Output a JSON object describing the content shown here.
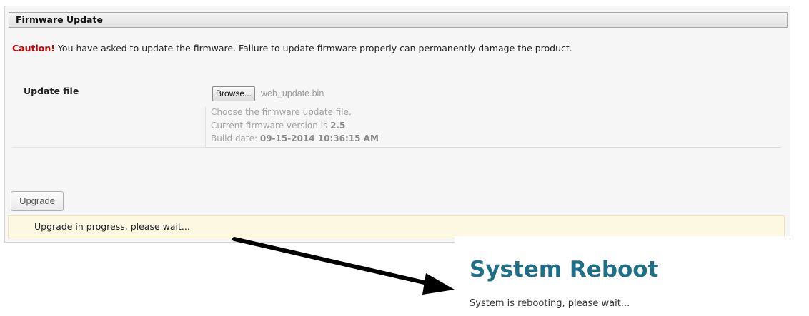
{
  "panel": {
    "title": "Firmware Update",
    "caution_label": "Caution!",
    "caution_text": " You have asked to update the firmware. Failure to update firmware properly can permanently damage the product."
  },
  "form": {
    "update_file_label": "Update file",
    "browse_label": "Browse...",
    "selected_file": "web_update.bin",
    "hint_choose": "Choose the firmware update file.",
    "current_version_prefix": "Current firmware version is ",
    "current_version": "2.5",
    "current_version_suffix": ".",
    "build_date_prefix": "Build date: ",
    "build_date": "09-15-2014 10:36:15 AM"
  },
  "actions": {
    "upgrade_label": "Upgrade"
  },
  "status": {
    "progress_text": "Upgrade in progress, please wait..."
  },
  "reboot": {
    "title": "System Reboot",
    "message": "System is rebooting, please wait..."
  },
  "colors": {
    "caution": "#cc0000",
    "reboot_title": "#1f6f86",
    "progress_bg": "#fdf8e2"
  }
}
